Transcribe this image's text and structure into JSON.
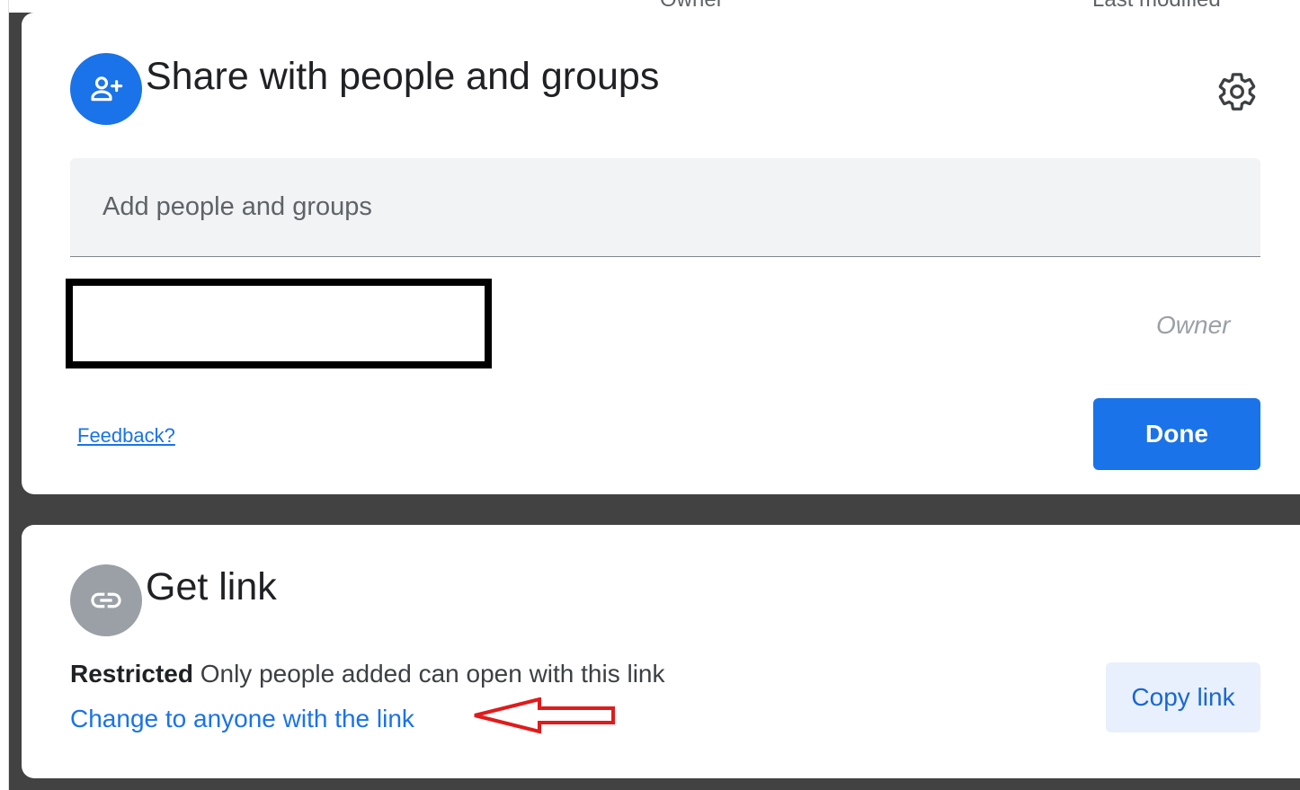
{
  "background": {
    "column_owner": "Owner",
    "column_last_modified": "Last modified"
  },
  "share_dialog": {
    "title": "Share with people and groups",
    "add_people_placeholder": "Add people and groups",
    "owner_role": "Owner",
    "feedback_label": "Feedback?",
    "done_label": "Done",
    "icons": {
      "avatar": "person-add-icon",
      "settings": "gear-icon"
    }
  },
  "link_dialog": {
    "title": "Get link",
    "restricted_label": "Restricted",
    "restricted_description": "Only people added can open with this link",
    "change_link_label": "Change to anyone with the link",
    "copy_link_label": "Copy link",
    "icons": {
      "avatar": "link-icon",
      "annotation": "arrow-left-icon"
    }
  },
  "colors": {
    "accent": "#1a73e8",
    "overlay": "#424242",
    "copy_button_bg": "#e8f0fe",
    "annotation_red": "#e01b1b"
  }
}
